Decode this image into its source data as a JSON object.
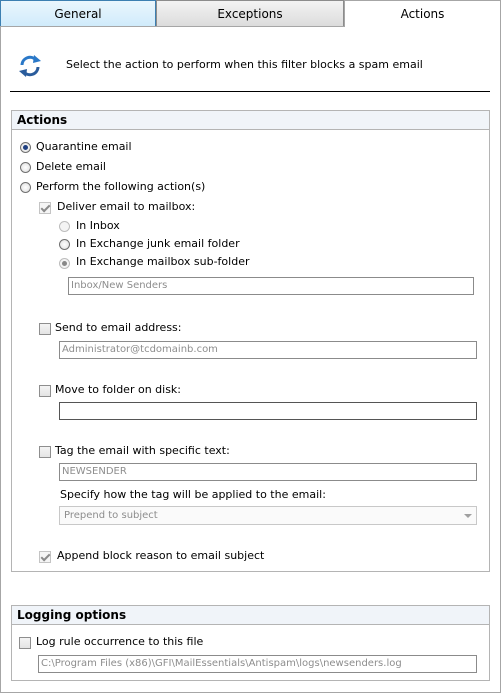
{
  "tabs": [
    {
      "label": "General",
      "state": "hover"
    },
    {
      "label": "Exceptions",
      "state": "normal"
    },
    {
      "label": "Actions",
      "state": "active"
    }
  ],
  "intro": {
    "icon": "refresh-arrows-icon",
    "text": "Select the action to perform when this filter blocks a spam email"
  },
  "actions": {
    "title": "Actions",
    "quarantine_label": "Quarantine email",
    "delete_label": "Delete email",
    "perform_label": "Perform the following action(s)",
    "deliver_label": "Deliver email to mailbox:",
    "inbox_label": "In Inbox",
    "junk_label": "In Exchange junk email folder",
    "subfolder_label": "In Exchange mailbox sub-folder",
    "subfolder_value": "Inbox/New Senders",
    "send_label": "Send to email address:",
    "send_value": "Administrator@tcdomainb.com",
    "move_label": "Move to folder on disk:",
    "move_value": "",
    "tag_label": "Tag the email with specific text:",
    "tag_value": "NEWSENDER",
    "tag_how_label": "Specify how the tag will be applied to the email:",
    "tag_how_value": "Prepend to subject",
    "append_label": "Append block reason to email subject"
  },
  "logging": {
    "title": "Logging options",
    "log_label": "Log rule occurrence to this file",
    "log_path": "C:\\Program Files (x86)\\GFI\\MailEssentials\\Antispam\\logs\\newsenders.log"
  },
  "colors": {
    "radio_dot": "#1e3f80",
    "group_header_bg": "#f0f4f9",
    "hover_tab": "#d0ebfb"
  }
}
